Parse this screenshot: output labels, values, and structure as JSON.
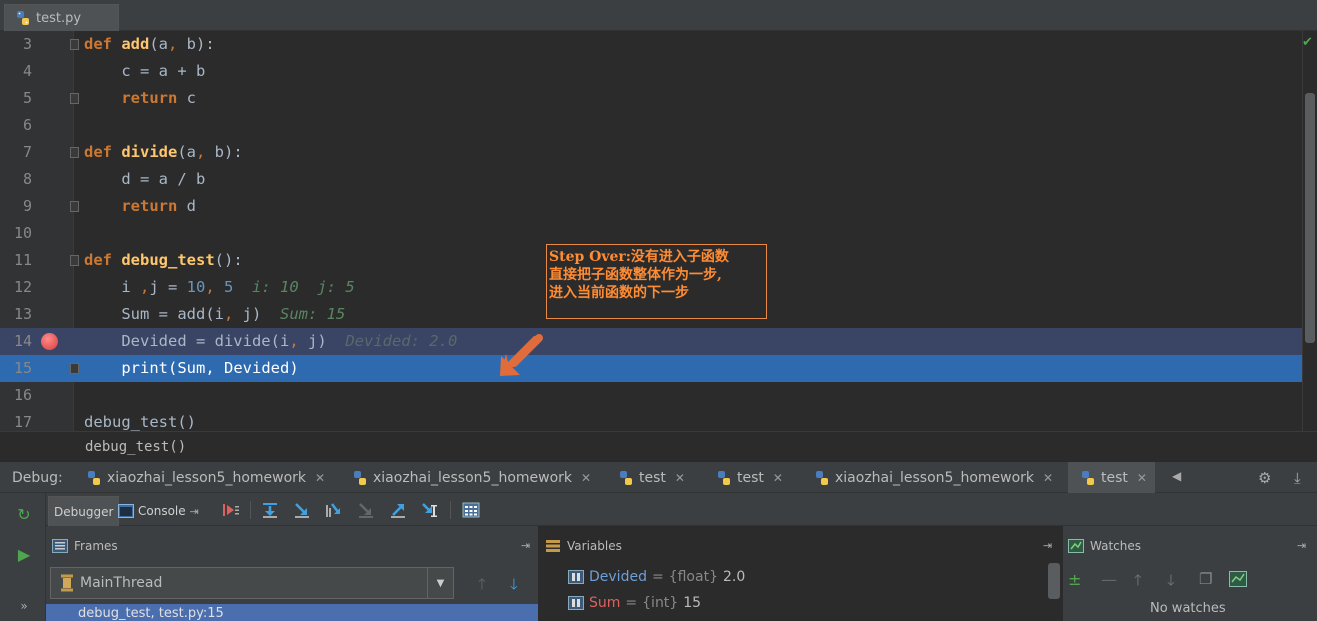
{
  "editor_tab": {
    "filename": "test.py",
    "icon": "python-file-icon"
  },
  "code_lines": [
    {
      "num": "3",
      "tokens": [
        [
          "kw",
          "def "
        ],
        [
          "fn",
          "add"
        ],
        [
          "plain",
          "(a"
        ],
        [
          "pun",
          ", "
        ],
        [
          "plain",
          "b):"
        ]
      ],
      "fold": true
    },
    {
      "num": "4",
      "tokens": [
        [
          "plain",
          "    c = a "
        ],
        [
          "plain",
          "+ b"
        ]
      ]
    },
    {
      "num": "5",
      "tokens": [
        [
          "kw",
          "    return "
        ],
        [
          "plain",
          "c"
        ]
      ],
      "fold": true
    },
    {
      "num": "6",
      "tokens": []
    },
    {
      "num": "7",
      "tokens": [
        [
          "kw",
          "def "
        ],
        [
          "fn",
          "divide"
        ],
        [
          "plain",
          "(a"
        ],
        [
          "pun",
          ", "
        ],
        [
          "plain",
          "b):"
        ]
      ],
      "fold": true
    },
    {
      "num": "8",
      "tokens": [
        [
          "plain",
          "    d = a "
        ],
        [
          "plain",
          "/ b"
        ]
      ]
    },
    {
      "num": "9",
      "tokens": [
        [
          "kw",
          "    return "
        ],
        [
          "plain",
          "d"
        ]
      ],
      "fold": true
    },
    {
      "num": "10",
      "tokens": []
    },
    {
      "num": "11",
      "tokens": [
        [
          "kw",
          "def "
        ],
        [
          "fn",
          "debug_test"
        ],
        [
          "plain",
          "():"
        ]
      ],
      "fold": true
    },
    {
      "num": "12",
      "tokens": [
        [
          "plain",
          "    i "
        ],
        [
          "pun",
          ","
        ],
        [
          "plain",
          "j = "
        ],
        [
          "num",
          "10"
        ],
        [
          "pun",
          ", "
        ],
        [
          "num",
          "5"
        ],
        [
          "inline",
          "  i: 10  j: 5"
        ]
      ]
    },
    {
      "num": "13",
      "tokens": [
        [
          "plain",
          "    Sum = add(i"
        ],
        [
          "pun",
          ", "
        ],
        [
          "plain",
          "j)"
        ],
        [
          "inline",
          "  Sum: 15"
        ]
      ]
    },
    {
      "num": "14",
      "tokens": [
        [
          "plain",
          "    Devided = divide(i"
        ],
        [
          "pun",
          ", "
        ],
        [
          "plain",
          "j)"
        ],
        [
          "inline-dim",
          "  Devided: 2.0"
        ]
      ],
      "breakpoint": true
    },
    {
      "num": "15",
      "tokens": [
        [
          "plain",
          "    print(Sum"
        ],
        [
          "plain",
          ", "
        ],
        [
          "plain",
          "Devided)"
        ]
      ],
      "exec": true,
      "fold": true
    },
    {
      "num": "16",
      "tokens": []
    },
    {
      "num": "17",
      "tokens": [
        [
          "plain",
          "debug_test()"
        ]
      ]
    }
  ],
  "annotation": {
    "line1": "Step Over:没有进入子函数",
    "line2": "直接把子函数整体作为一步,",
    "line3": "进入当前函数的下一步"
  },
  "breadcrumb": "debug_test()",
  "debug_bar": {
    "label": "Debug:",
    "tabs": [
      {
        "label": "xiaozhai_lesson5_homework"
      },
      {
        "label": "xiaozhai_lesson5_homework"
      },
      {
        "label": "test"
      },
      {
        "label": "test"
      },
      {
        "label": "xiaozhai_lesson5_homework"
      },
      {
        "label": "test"
      }
    ]
  },
  "subtabs": {
    "debugger": "Debugger",
    "console": "Console"
  },
  "panels": {
    "frames_title": "Frames",
    "variables_title": "Variables",
    "watches_title": "Watches"
  },
  "thread": {
    "name": "MainThread"
  },
  "frame_row": "debug_test, test.py:15",
  "variables": [
    {
      "name": "Devided",
      "type": "{float}",
      "value": "2.0"
    },
    {
      "name": "Sum",
      "type": "{int}",
      "value": "15"
    }
  ],
  "watches_empty": "No watches",
  "colors": {
    "keyword": "#cc7832",
    "function": "#ffc66d",
    "number": "#6897bb",
    "exec_line": "#2d6ab0",
    "breakpoint_line": "#3a4465",
    "annotation": "#ff8c33"
  }
}
